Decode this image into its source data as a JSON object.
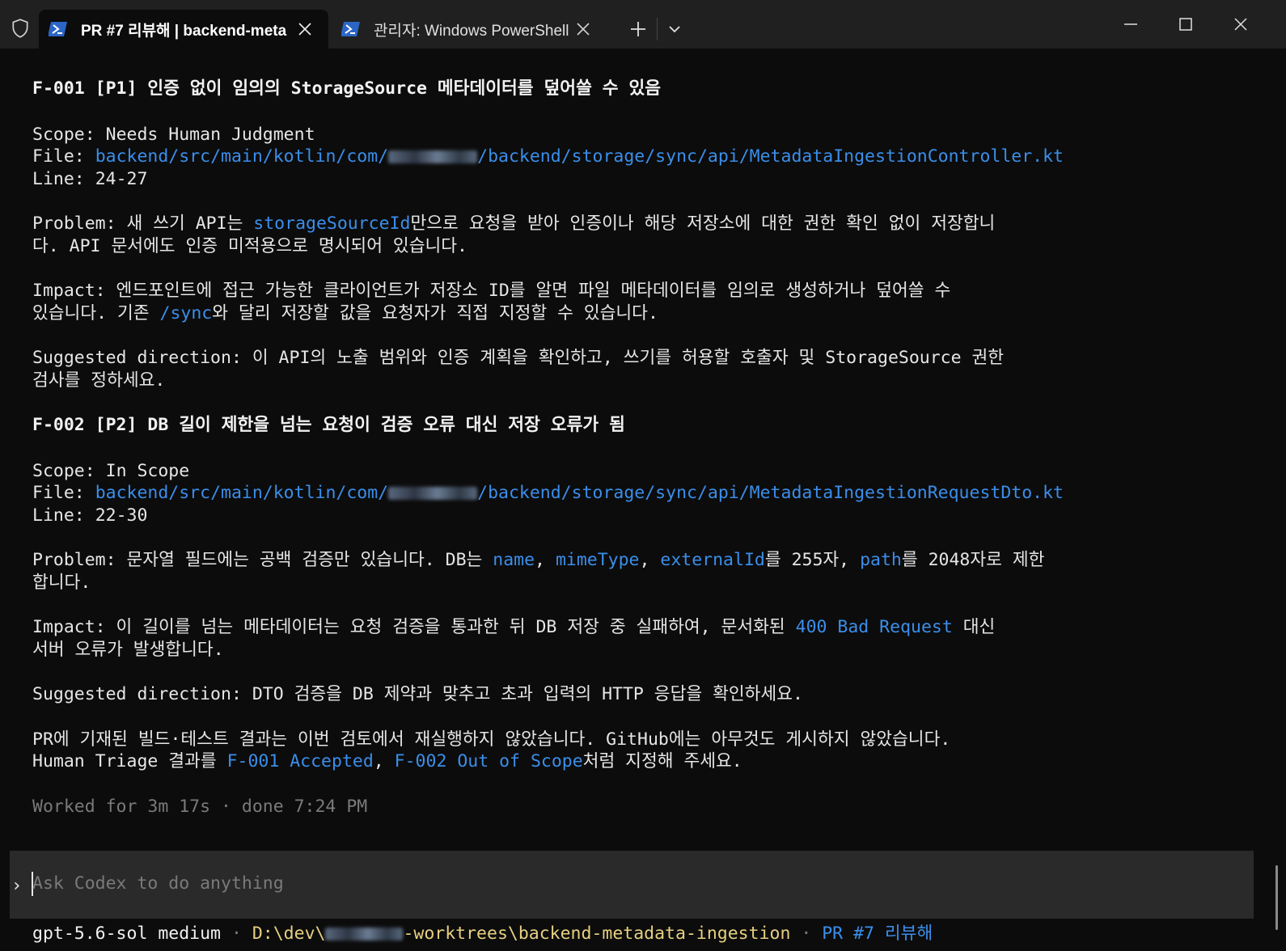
{
  "tabs": [
    {
      "title": "PR #7 리뷰해 | backend-meta",
      "active": true
    },
    {
      "title": "관리자: Windows PowerShell",
      "active": false
    }
  ],
  "findings": [
    {
      "heading": "F-001 [P1] 인증 없이 임의의 StorageSource 메타데이터를 덮어쓸 수 있음",
      "scope_label": "Scope:",
      "scope_value": "Needs Human Judgment",
      "file_label": "File:",
      "file_prefix": "backend/src/main/kotlin/com/",
      "file_suffix": "/backend/storage/sync/api/MetadataIngestionController.kt",
      "line_label": "Line:",
      "line_value": "24-27",
      "problem_label": "Problem:",
      "problem_1a": " 새 쓰기 API는 ",
      "problem_1_link": "storageSourceId",
      "problem_1b": "만으로 요청을 받아 인증이나 해당 저장소에 대한 권한 확인 없이 저장합니",
      "problem_2": "다. API 문서에도 인증 미적용으로 명시되어 있습니다.",
      "impact_label": "Impact:",
      "impact_1": " 엔드포인트에 접근 가능한 클라이언트가 저장소 ID를 알면 파일 메타데이터를 임의로 생성하거나 덮어쓸 수",
      "impact_2a": "있습니다. 기존 ",
      "impact_2_link": "/sync",
      "impact_2b": "와 달리 저장할 값을 요청자가 직접 지정할 수 있습니다.",
      "suggested_label": "Suggested direction:",
      "suggested_1": " 이 API의 노출 범위와 인증 계획을 확인하고, 쓰기를 허용할 호출자 및 StorageSource 권한",
      "suggested_2": "검사를 정하세요."
    },
    {
      "heading": "F-002 [P2] DB 길이 제한을 넘는 요청이 검증 오류 대신 저장 오류가 됨",
      "scope_label": "Scope:",
      "scope_value": "In Scope",
      "file_label": "File:",
      "file_prefix": "backend/src/main/kotlin/com/",
      "file_suffix": "/backend/storage/sync/api/MetadataIngestionRequestDto.kt",
      "line_label": "Line:",
      "line_value": "22-30",
      "problem_label": "Problem:",
      "problem_1a": " 문자열 필드에는 공백 검증만 있습니다. DB는 ",
      "problem_1_name": "name",
      "problem_1_comma1": ", ",
      "problem_1_mime": "mimeType",
      "problem_1_comma2": ", ",
      "problem_1_ext": "externalId",
      "problem_1_mid": "를 255자, ",
      "problem_1_path": "path",
      "problem_1_end": "를 2048자로 제한",
      "problem_2": "합니다.",
      "impact_label": "Impact:",
      "impact_1a": " 이 길이를 넘는 메타데이터는 요청 검증을 통과한 뒤 DB 저장 중 실패하여, 문서화된 ",
      "impact_1_link": "400 Bad Request",
      "impact_1b": " 대신",
      "impact_2": "서버 오류가 발생합니다.",
      "suggested_label": "Suggested direction:",
      "suggested_1": " DTO 검증을 DB 제약과 맞추고 초과 입력의 HTTP 응답을 확인하세요."
    }
  ],
  "summary": {
    "line_1": "PR에 기재된 빌드·테스트 결과는 이번 검토에서 재실행하지 않았습니다. GitHub에는 아무것도 게시하지 않았습니다.",
    "line_2a": "Human Triage 결과를 ",
    "line_2_link1": "F-001 Accepted",
    "line_2_comma": ", ",
    "line_2_link2": "F-002 Out of Scope",
    "line_2b": "처럼 지정해 주세요."
  },
  "worked": "Worked for 3m 17s · done 7:24 PM",
  "input": {
    "placeholder": "Ask Codex to do anything",
    "prompt": "›"
  },
  "status": {
    "model": "gpt-5.6-sol medium",
    "separator": " · ",
    "path_prefix": "D:\\dev\\",
    "path_suffix": "-worktrees\\backend-metadata-ingestion",
    "pr": "PR #7 리뷰해"
  }
}
